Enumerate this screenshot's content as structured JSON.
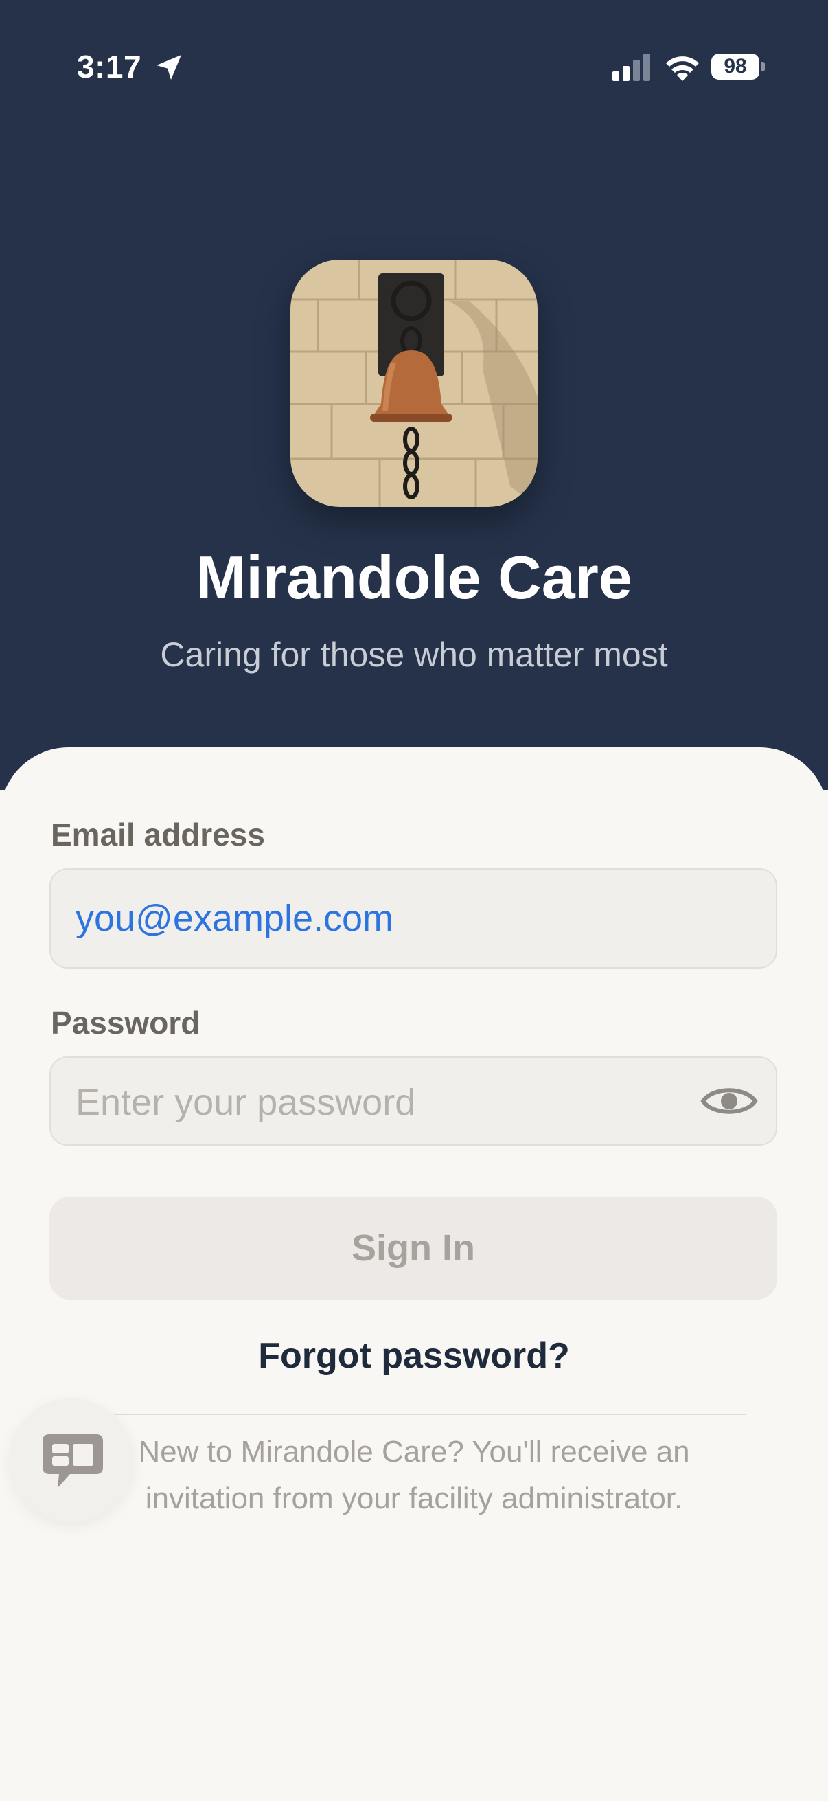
{
  "status_bar": {
    "time": "3:17",
    "battery": "98",
    "icons": [
      "location-arrow-icon",
      "cellular-signal-icon",
      "wifi-icon",
      "battery-icon"
    ]
  },
  "header": {
    "app_icon": "bell-icon",
    "title": "Mirandole Care",
    "subtitle": "Caring for those who matter most"
  },
  "form": {
    "email_label": "Email address",
    "email_value": "you@example.com",
    "password_label": "Password",
    "password_placeholder": "Enter your password",
    "show_password_icon": "eye-icon",
    "signin_label": "Sign In",
    "forgot_label": "Forgot password?"
  },
  "footer": {
    "info_text": "New to Mirandole Care? You'll receive an invitation from your facility administrator.",
    "chat_icon": "chat-support-icon"
  },
  "colors": {
    "header_bg": "#25324a",
    "sheet_bg": "#f8f7f4",
    "link_blue": "#2e74e0",
    "text_dark": "#1f2a3d"
  }
}
